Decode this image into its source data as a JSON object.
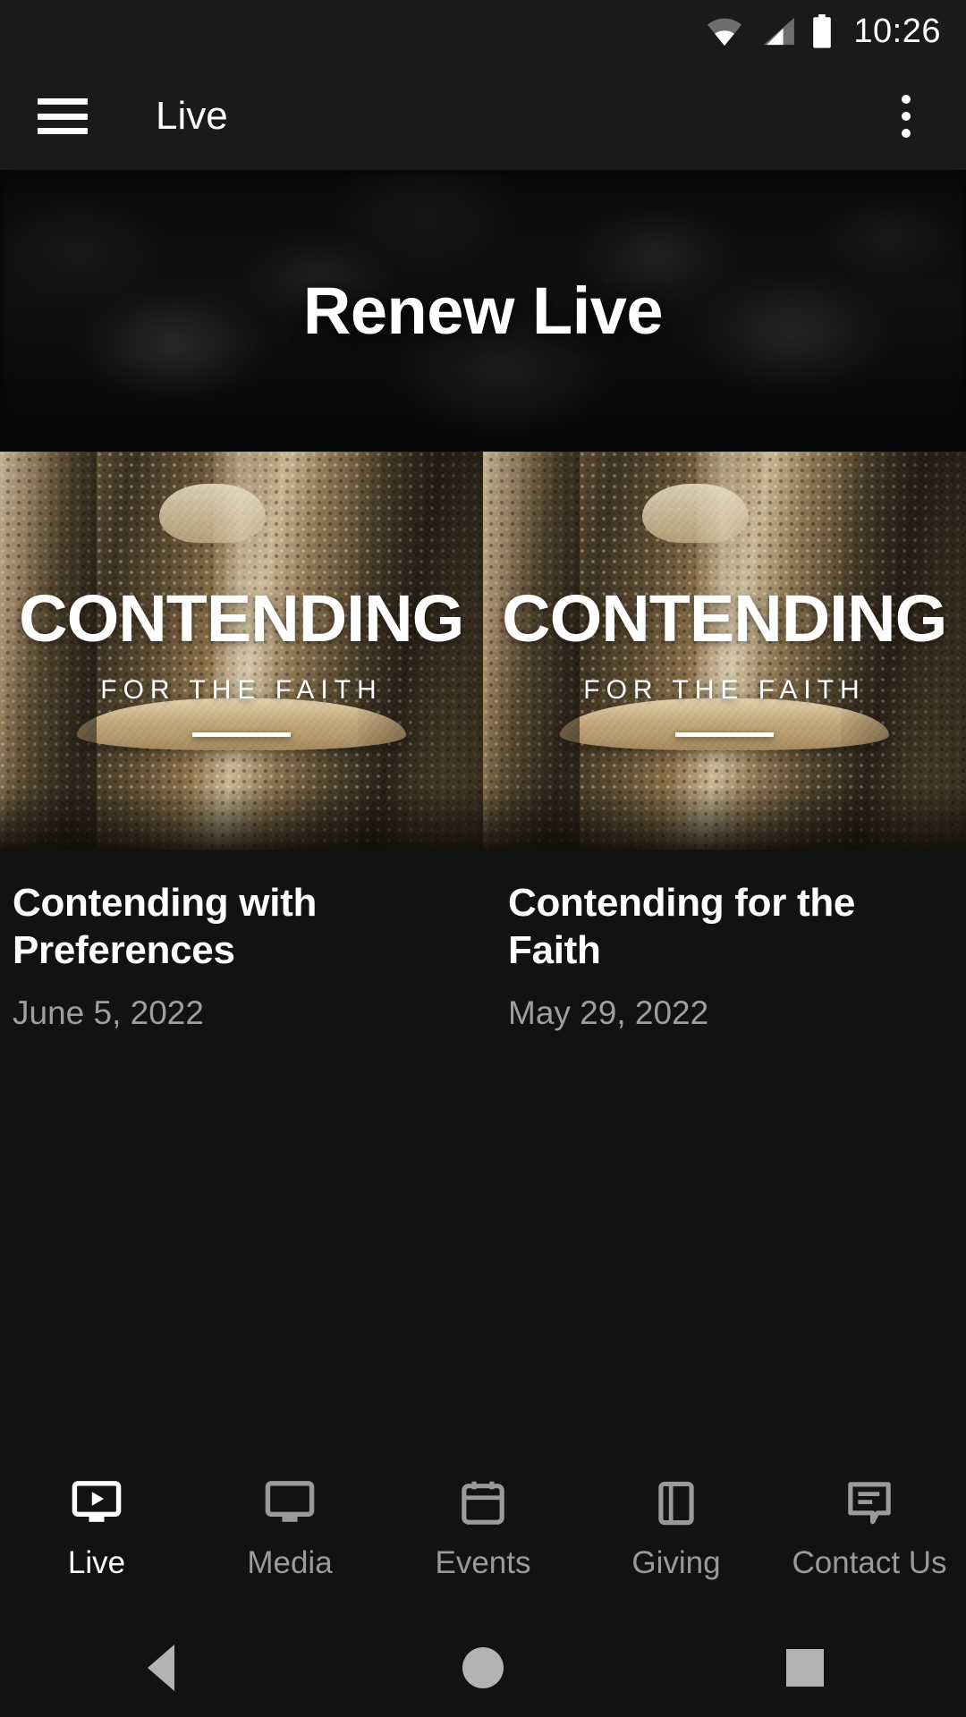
{
  "status_bar": {
    "time": "10:26",
    "icons": [
      "wifi-icon",
      "cellular-signal-icon",
      "battery-icon"
    ]
  },
  "app_bar": {
    "menu_icon": "hamburger-menu-icon",
    "title": "Live",
    "overflow_icon": "overflow-menu-icon"
  },
  "hero": {
    "title": "Renew Live"
  },
  "sermons": [
    {
      "artwork_main": "CONTENDING",
      "artwork_sub": "FOR THE FAITH",
      "title": "Contending with Preferences",
      "date": "June 5, 2022"
    },
    {
      "artwork_main": "CONTENDING",
      "artwork_sub": "FOR THE FAITH",
      "title": "Contending for the Faith",
      "date": "May 29, 2022"
    }
  ],
  "tabs": [
    {
      "label": "Live",
      "icon": "live-tv-play-icon",
      "active": true
    },
    {
      "label": "Media",
      "icon": "monitor-icon",
      "active": false
    },
    {
      "label": "Events",
      "icon": "calendar-icon",
      "active": false
    },
    {
      "label": "Giving",
      "icon": "book-icon",
      "active": false
    },
    {
      "label": "Contact Us",
      "icon": "speech-bubble-icon",
      "active": false
    }
  ],
  "android_nav": {
    "back": "back-triangle-icon",
    "home": "home-circle-icon",
    "recents": "recents-square-icon"
  },
  "colors": {
    "background": "#121212",
    "bar_background": "#1a1a1a",
    "text_primary": "#ffffff",
    "text_secondary": "#9e9e9e",
    "tab_inactive": "#9a9a9a",
    "nav_icon": "#b3b3b3"
  }
}
